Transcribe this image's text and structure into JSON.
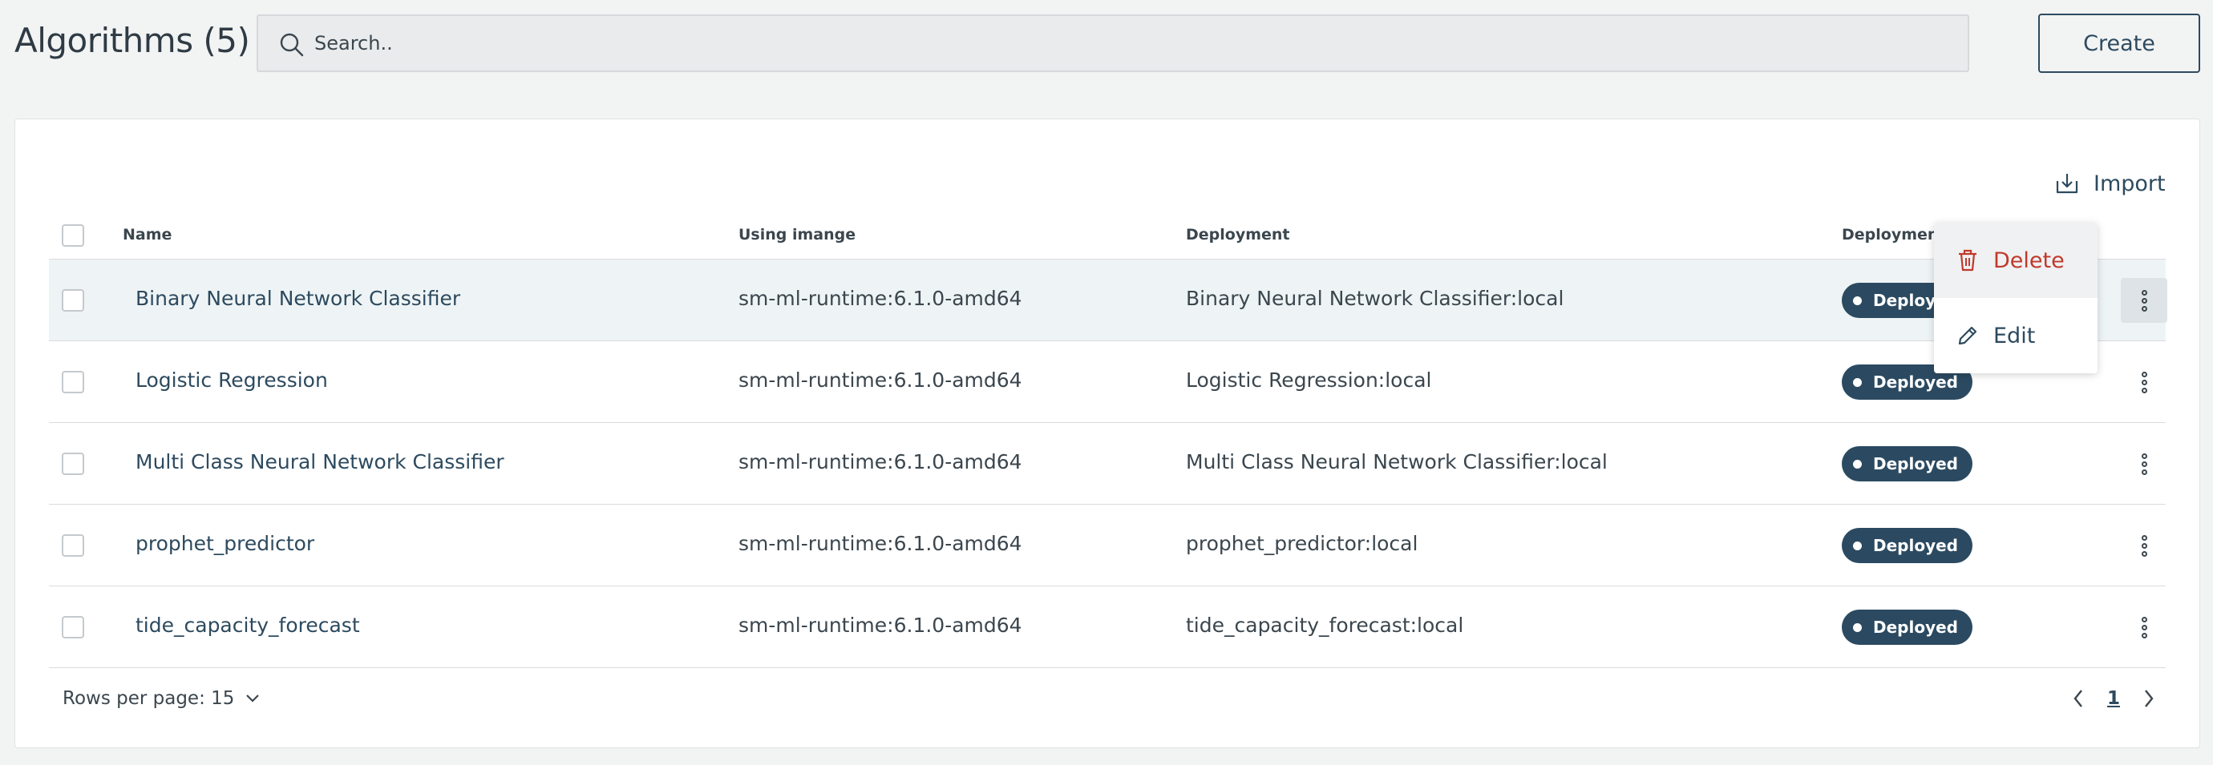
{
  "header": {
    "title": "Algorithms (5)",
    "search_placeholder": "Search..",
    "create_label": "Create"
  },
  "card": {
    "import_label": "Import"
  },
  "table": {
    "columns": {
      "name": "Name",
      "image": "Using imange",
      "deployment": "Deployment",
      "status": "Deployment sta"
    },
    "rows": [
      {
        "name": "Binary Neural Network Classifier",
        "image": "sm-ml-runtime:6.1.0-amd64",
        "deployment": "Binary Neural Network Classifier:local",
        "status": "Deployed"
      },
      {
        "name": "Logistic Regression",
        "image": "sm-ml-runtime:6.1.0-amd64",
        "deployment": "Logistic Regression:local",
        "status": "Deployed"
      },
      {
        "name": "Multi Class Neural Network Classifier",
        "image": "sm-ml-runtime:6.1.0-amd64",
        "deployment": "Multi Class Neural Network Classifier:local",
        "status": "Deployed"
      },
      {
        "name": "prophet_predictor",
        "image": "sm-ml-runtime:6.1.0-amd64",
        "deployment": "prophet_predictor:local",
        "status": "Deployed"
      },
      {
        "name": "tide_capacity_forecast",
        "image": "sm-ml-runtime:6.1.0-amd64",
        "deployment": "tide_capacity_forecast:local",
        "status": "Deployed"
      }
    ]
  },
  "footer": {
    "rows_per_page": "Rows per page: 15",
    "current_page": "1"
  },
  "context_menu": {
    "delete_label": "Delete",
    "edit_label": "Edit"
  },
  "colors": {
    "accent": "#2d4a5f",
    "badge": "#2b4a61",
    "danger": "#c0392b",
    "background": "#f2f3f3"
  },
  "icons": {
    "search": "search-icon",
    "import": "import-icon",
    "kebab": "kebab-menu-icon",
    "delete": "trash-icon",
    "edit": "pencil-icon",
    "chevron_down": "chevron-down-icon",
    "prev": "chevron-left-icon",
    "next": "chevron-right-icon"
  }
}
